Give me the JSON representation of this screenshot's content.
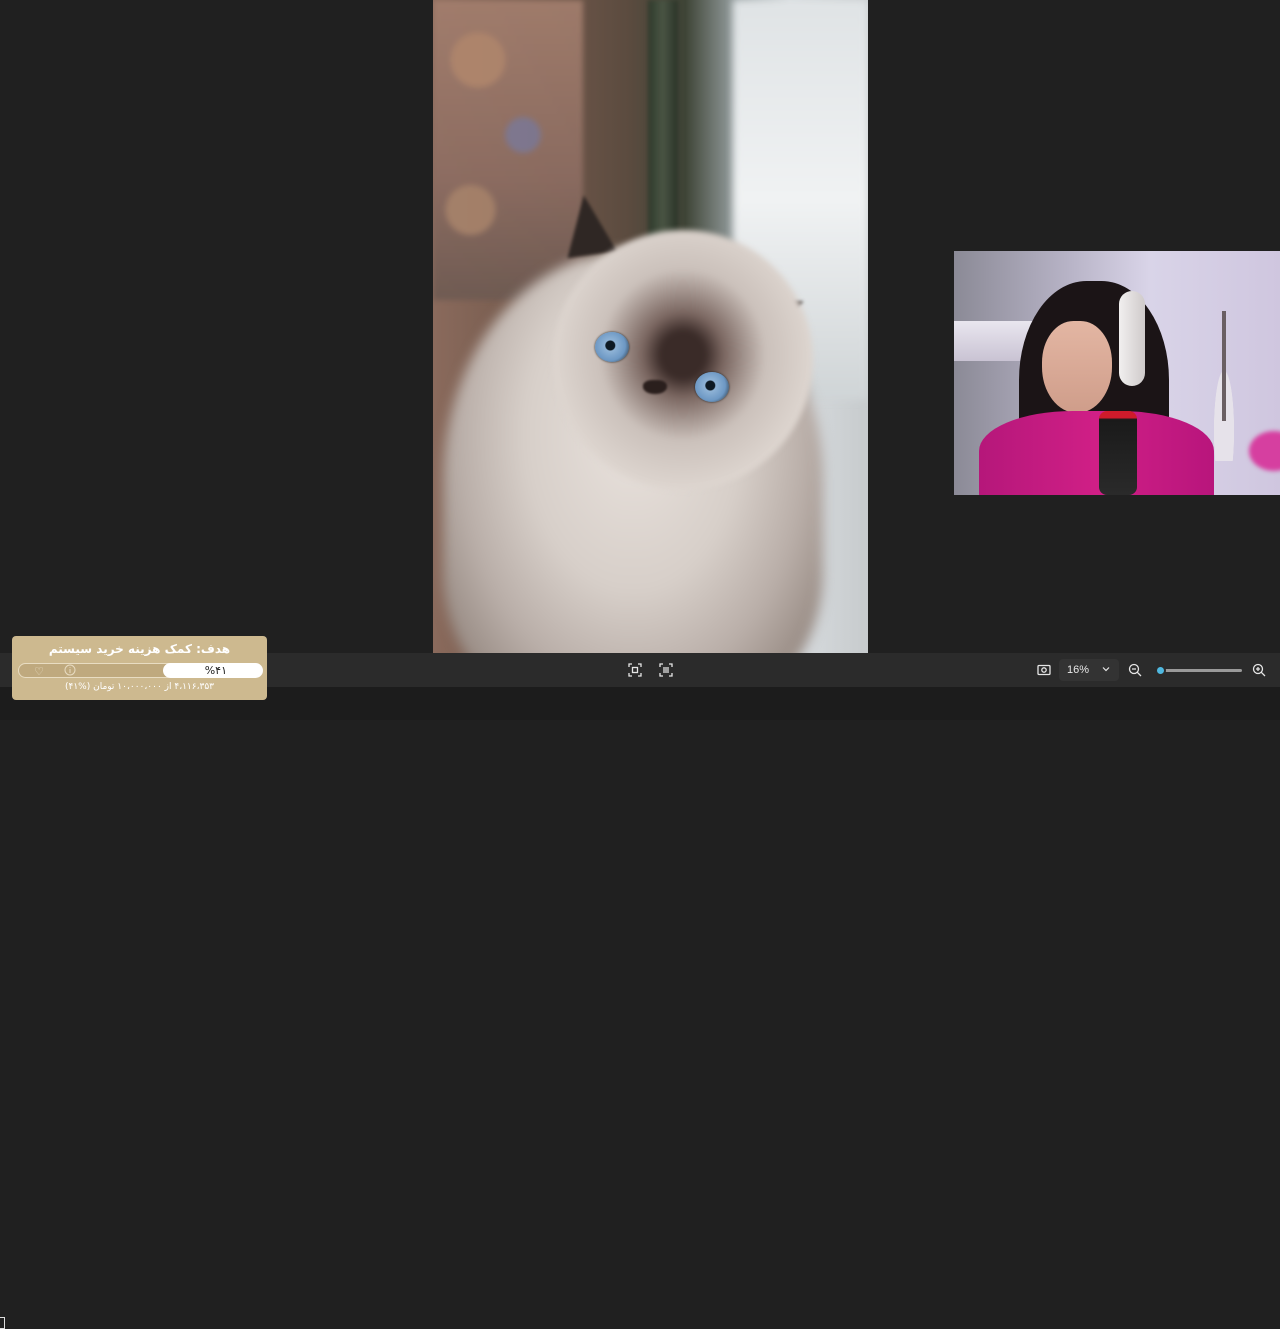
{
  "viewer": {
    "image_subject": "cat-photo",
    "webcam": "streamer-webcam"
  },
  "toolbar": {
    "zoom_value": "16%",
    "zoom_slider_level": 0.05,
    "icons": [
      "fit-to-screen-icon",
      "actual-size-icon",
      "screenshot-icon",
      "chevron-down-icon",
      "zoom-out-icon",
      "zoom-in-icon"
    ]
  },
  "goal_widget": {
    "title": "هدف: کمک هزینه خرید سیستم",
    "percent_label": "%۴۱",
    "progress": 0.41,
    "subtitle": "۴،۱۱۶،۳۵۳ از ۱۰،۰۰۰،۰۰۰ تومان (%۴۱)",
    "icons": [
      "heart-icon",
      "info-icon"
    ],
    "colors": {
      "background": "#cdb98f",
      "fill": "#ffffff"
    }
  }
}
